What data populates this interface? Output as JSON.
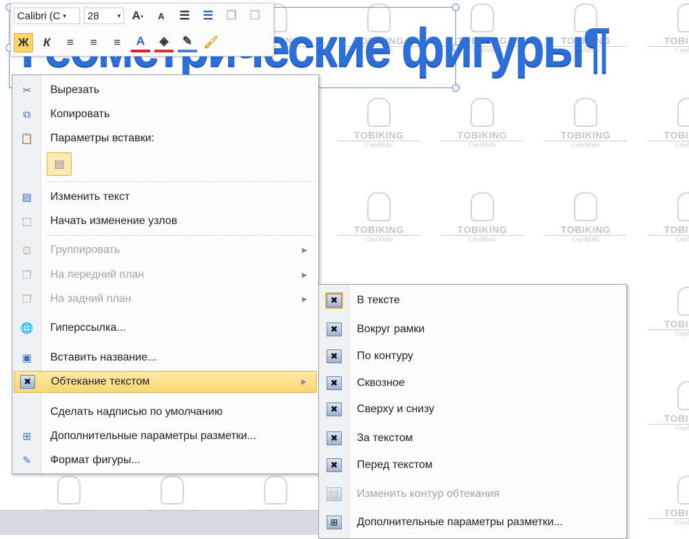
{
  "wordart": {
    "text": "Геометрические фигуры¶"
  },
  "watermark": {
    "brand": "TOBIKING",
    "sub": "СтудИзба"
  },
  "mini_toolbar": {
    "font": "Calibri (С",
    "size": "28",
    "bold": "Ж",
    "italic": "К",
    "grow": "A",
    "shrink": "A",
    "font_color": "A"
  },
  "context_menu": {
    "items": [
      {
        "label": "Вырезать",
        "icon": "scissors-icon",
        "enabled": true
      },
      {
        "label": "Копировать",
        "icon": "copy-icon",
        "enabled": true
      },
      {
        "label": "Параметры вставки:",
        "icon": "paste-icon",
        "enabled": true
      },
      {
        "label": "Изменить текст",
        "icon": "edit-text-icon",
        "enabled": true
      },
      {
        "label": "Начать изменение узлов",
        "icon": "edit-points-icon",
        "enabled": true
      },
      {
        "label": "Группировать",
        "icon": "group-icon",
        "enabled": false
      },
      {
        "label": "На передний план",
        "icon": "bring-front-icon",
        "enabled": false
      },
      {
        "label": "На задний план",
        "icon": "send-back-icon",
        "enabled": false
      },
      {
        "label": "Гиперссылка...",
        "icon": "hyperlink-icon",
        "enabled": true
      },
      {
        "label": "Вставить название...",
        "icon": "caption-icon",
        "enabled": true
      },
      {
        "label": "Обтекание текстом",
        "icon": "text-wrap-icon",
        "enabled": true
      },
      {
        "label": "Сделать надписью по умолчанию",
        "icon": "",
        "enabled": true
      },
      {
        "label": "Дополнительные параметры разметки...",
        "icon": "layout-icon",
        "enabled": true
      },
      {
        "label": "Формат фигуры...",
        "icon": "format-shape-icon",
        "enabled": true
      }
    ]
  },
  "submenu": {
    "items": [
      {
        "label": "В тексте",
        "enabled": true
      },
      {
        "label": "Вокруг рамки",
        "enabled": true
      },
      {
        "label": "По контуру",
        "enabled": true
      },
      {
        "label": "Сквозное",
        "enabled": true
      },
      {
        "label": "Сверху и снизу",
        "enabled": true
      },
      {
        "label": "За текстом",
        "enabled": true
      },
      {
        "label": "Перед текстом",
        "enabled": true
      },
      {
        "label": "Изменить контур обтекания",
        "enabled": false
      },
      {
        "label": "Дополнительные параметры разметки...",
        "enabled": true
      }
    ]
  }
}
